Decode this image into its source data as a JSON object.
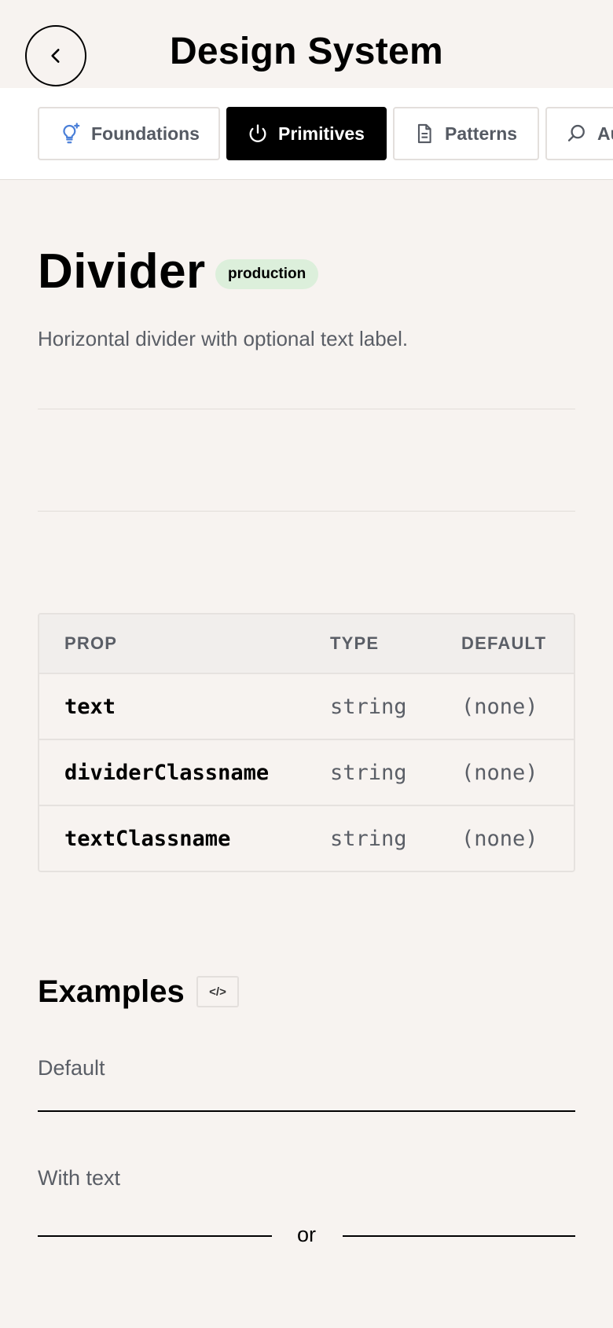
{
  "header": {
    "title": "Design System",
    "back_icon": "chevron-left-icon"
  },
  "tabs": [
    {
      "label": "Foundations",
      "icon": "lightbulb-icon",
      "active": false
    },
    {
      "label": "Primitives",
      "icon": "power-icon",
      "active": true
    },
    {
      "label": "Patterns",
      "icon": "document-icon",
      "active": false
    },
    {
      "label": "Au",
      "icon": "search-icon",
      "active": false
    }
  ],
  "component": {
    "title": "Divider",
    "status": "production",
    "description": "Horizontal divider with optional text label."
  },
  "props_table": {
    "headers": [
      "PROP",
      "TYPE",
      "DEFAULT"
    ],
    "rows": [
      [
        "text",
        "string",
        "(none)"
      ],
      [
        "dividerClassname",
        "string",
        "(none)"
      ],
      [
        "textClassname",
        "string",
        "(none)"
      ]
    ]
  },
  "examples": {
    "title": "Examples",
    "code_toggle": "</>",
    "default_label": "Default",
    "with_text_label": "With text",
    "with_text_value": "or"
  },
  "colors": {
    "background": "#f7f3f0",
    "badge_bg": "#dcefdb",
    "muted_text": "#5a5e66",
    "tab_icon_accent": "#4a7fd8"
  }
}
